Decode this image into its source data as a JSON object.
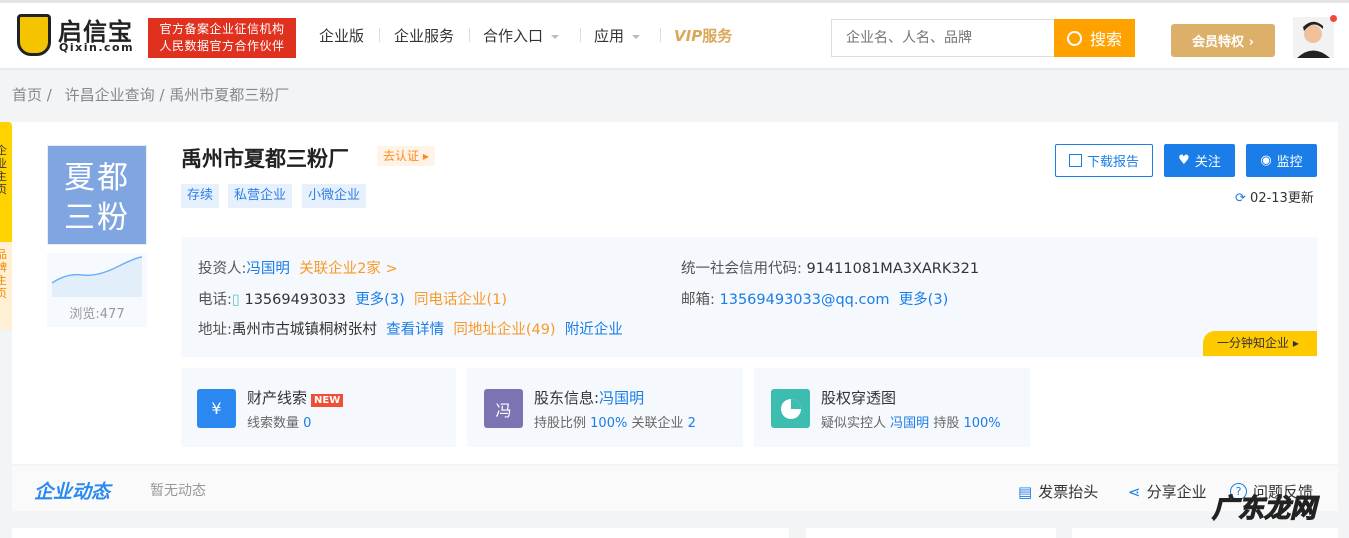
{
  "header": {
    "logo_name": "启信宝",
    "logo_domain": "Qixin.com",
    "badge_line1": "官方备案企业征信机构",
    "badge_line2": "人民数据官方合作伙伴",
    "nav": [
      "企业版",
      "企业服务",
      "合作入口",
      "应用"
    ],
    "vip_prefix": "VIP",
    "vip_label": "服务",
    "search_placeholder": "企业名、人名、品牌",
    "search_button": "搜索",
    "member_button": "会员特权 ›"
  },
  "side_tab": {
    "top": "企业主页",
    "bottom": "品牌主页"
  },
  "breadcrumb": [
    "首页 /",
    "许昌企业查询 /",
    "禹州市夏都三粉厂"
  ],
  "company": {
    "logo_text_1": "夏都",
    "logo_text_2": "三粉",
    "views": "浏览:477",
    "name": "禹州市夏都三粉厂",
    "verify": "去认证 ▸",
    "tags": [
      "存续",
      "私营企业",
      "小微企业"
    ],
    "actions": {
      "download": "下载报告",
      "follow": "关注",
      "monitor": "监控"
    },
    "updated": "02-13更新",
    "info": {
      "investor_label": "投资人:",
      "investor": "冯国明",
      "related": "关联企业2家 >",
      "credit_label": "统一社会信用代码:",
      "credit_code": "91411081MA3XARK321",
      "phone_label": "电话:",
      "phone": "13569493033",
      "phone_more": "更多(3)",
      "same_phone": "同电话企业(1)",
      "email_label": "邮箱:",
      "email": "13569493033@qq.com",
      "email_more": "更多(3)",
      "address_label": "地址:",
      "address": "禹州市古城镇桐树张村",
      "view_detail": "查看详情",
      "same_address": "同地址企业(49)",
      "nearby": "附近企业"
    },
    "minute_button": "一分钟知企业 ▸"
  },
  "cards": [
    {
      "icon": "¥",
      "title": "财产线索",
      "badge": "NEW",
      "sub_label": "线索数量",
      "sub_value": "0"
    },
    {
      "icon": "冯",
      "title": "股东信息:",
      "title_link": "冯国明",
      "sub_label": "持股比例",
      "sub_value": "100%",
      "sub_label2": "关联企业",
      "sub_value2": "2"
    },
    {
      "title": "股权穿透图",
      "sub_label": "疑似实控人",
      "sub_link": "冯国明",
      "sub_label2": "持股",
      "sub_value2": "100%"
    }
  ],
  "dynamics": {
    "title": "企业动态",
    "empty": "暂无动态",
    "tools": [
      "发票抬头",
      "分享企业",
      "问题反馈"
    ]
  },
  "watermark": "广东龙网"
}
